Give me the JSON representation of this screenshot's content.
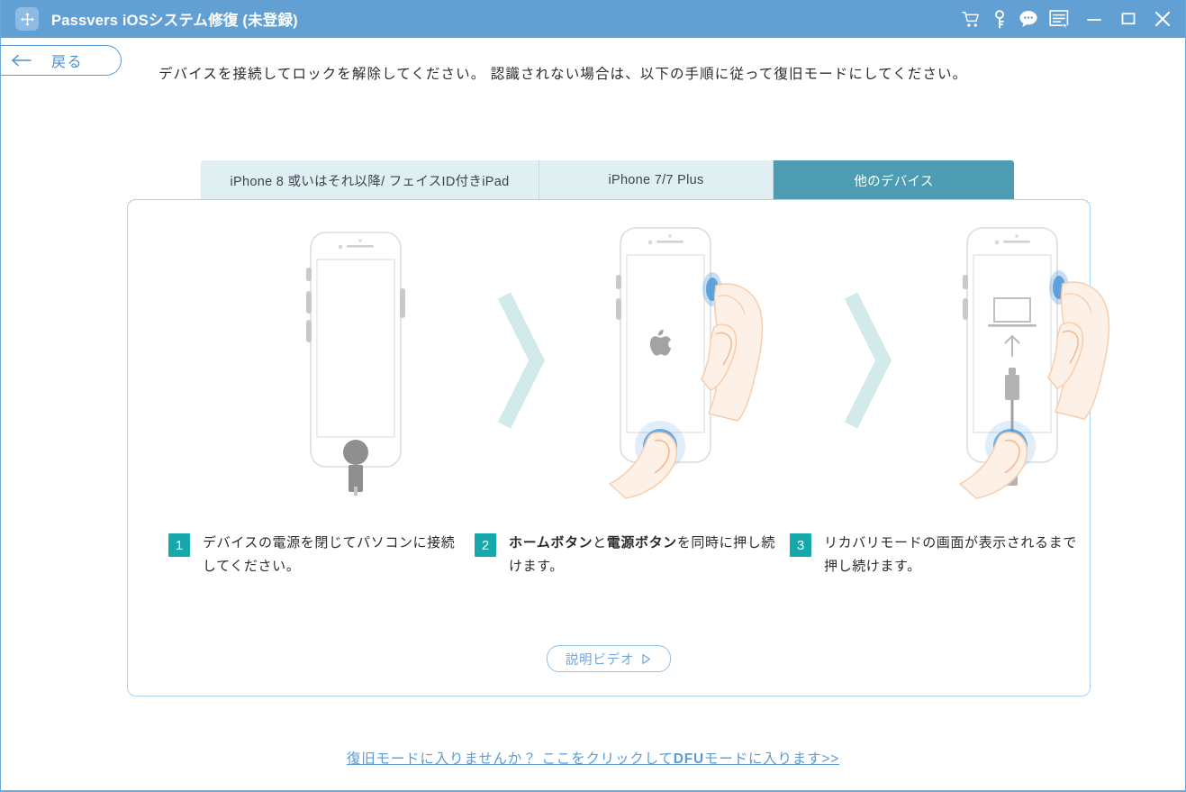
{
  "window": {
    "title": "Passvers iOSシステム修復 (未登録)",
    "logo_icon": "move-arrows-logo-icon",
    "titlebar_icons": [
      {
        "name": "cart-icon",
        "label": "カート"
      },
      {
        "name": "key-icon",
        "label": "登録"
      },
      {
        "name": "chat-bubble-icon",
        "label": "サポート"
      },
      {
        "name": "menu-list-icon",
        "label": "メニュー"
      },
      {
        "name": "minimize-icon",
        "label": "最小化"
      },
      {
        "name": "maximize-icon",
        "label": "最大化"
      },
      {
        "name": "close-icon",
        "label": "閉じる"
      }
    ]
  },
  "nav": {
    "back_label": "戻る",
    "back_icon": "arrow-left-icon"
  },
  "header": {
    "instruction": "デバイスを接続してロックを解除してください。 認識されない場合は、以下の手順に従って復旧モードにしてください。"
  },
  "tabs": [
    {
      "label": "iPhone 8 或いはそれ以降/ フェイスID付きiPad",
      "active": false
    },
    {
      "label": "iPhone 7/7 Plus",
      "active": false
    },
    {
      "label": "他のデバイス",
      "active": true
    }
  ],
  "steps": [
    {
      "number": "1",
      "text": "デバイスの電源を閉じてパソコンに接続してください。",
      "illustration": "phone-with-cable-icon"
    },
    {
      "number": "2",
      "text_html": "<b>ホームボタン</b>と<b>電源ボタン</b>を同時に押し続けます。",
      "text": "ホームボタンと電源ボタンを同時に押し続けます。",
      "illustration": "phone-apple-logo-two-fingers-icon"
    },
    {
      "number": "3",
      "text": "リカバリモードの画面が表示されるまで押し続けます。",
      "illustration": "phone-recovery-mode-screen-icon"
    }
  ],
  "video_button": {
    "label": "説明ビデオ",
    "icon": "play-triangle-icon"
  },
  "footer": {
    "link_text": "復旧モードに入りませんか？ ここをクリックしてDFUモードに入ります>>",
    "link_html": "復旧モードに入りませんか？ ここをクリックして<b>DFU</b>モードに入ります>>"
  },
  "colors": {
    "titlebar_blue": "#62a0d4",
    "tab_active_teal": "#4d9cb1",
    "tab_inactive": "#e0eff2",
    "badge_teal": "#16a8ab",
    "panel_border": "#a8d2ef",
    "link_blue": "#5b9bd5",
    "chevron_mint": "#d3eaea"
  }
}
